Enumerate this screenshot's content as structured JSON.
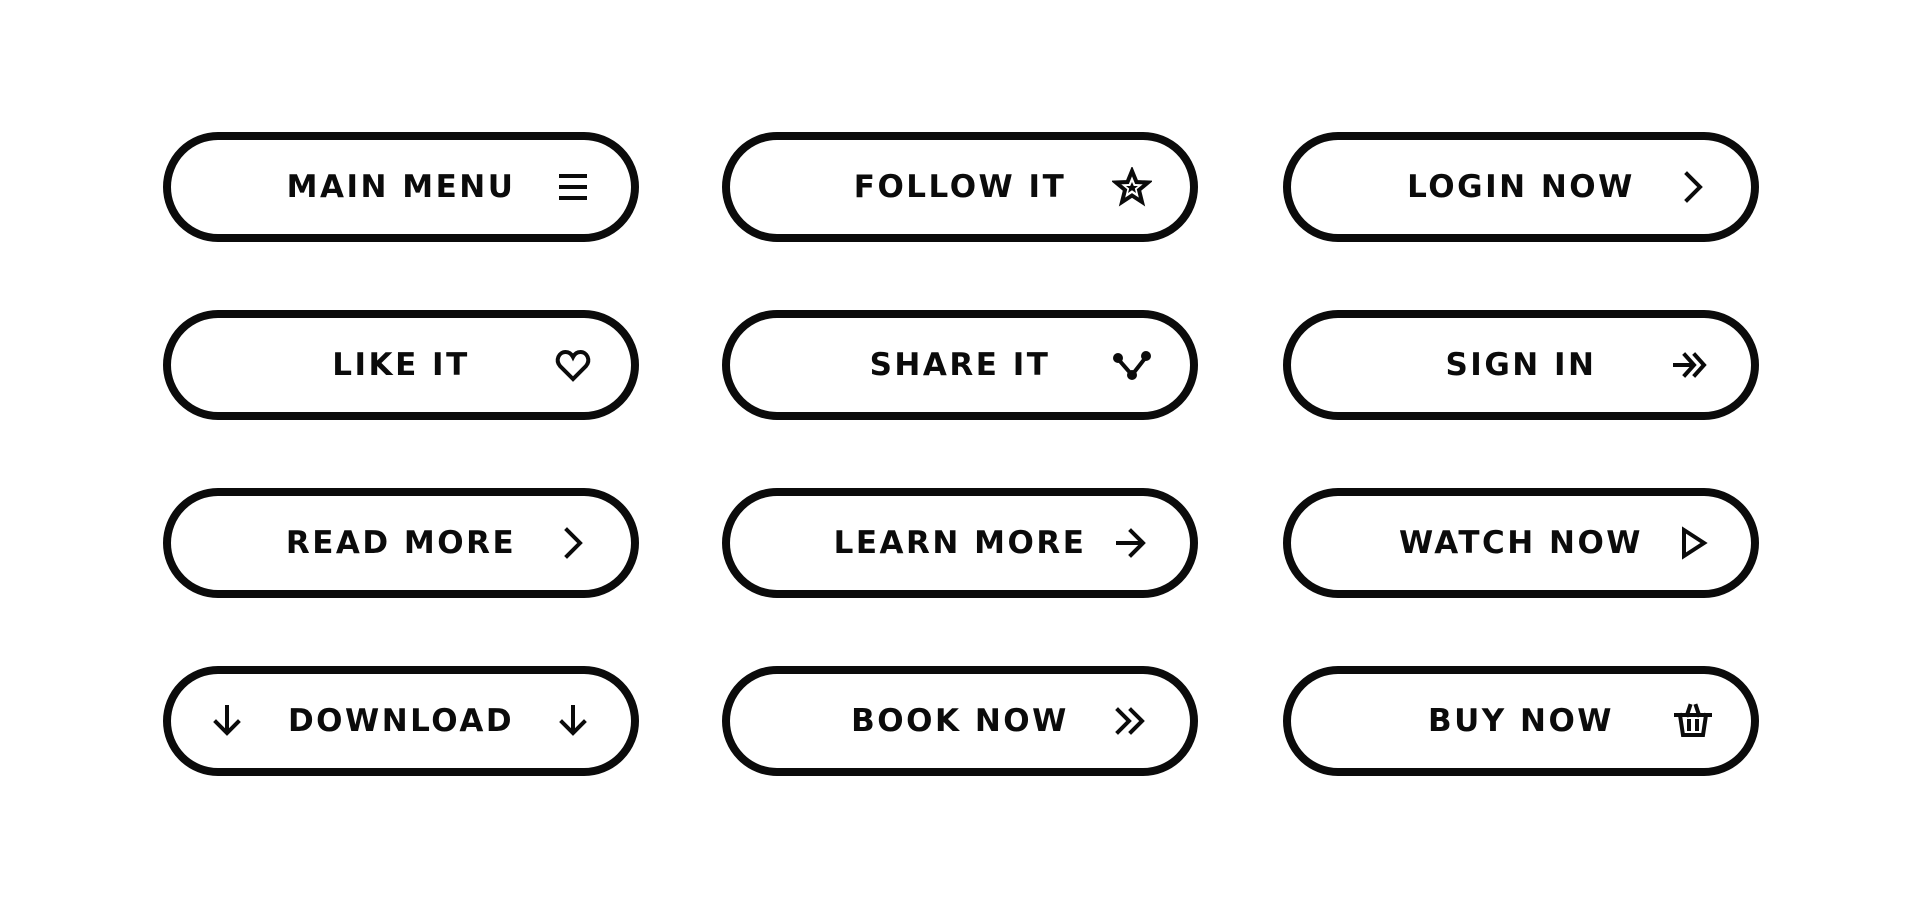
{
  "colors": {
    "stroke": "#0b0b0b",
    "background": "#ffffff"
  },
  "buttons": [
    {
      "label": "MAIN MENU",
      "icon": "menu-icon"
    },
    {
      "label": "FOLLOW IT",
      "icon": "star-icon"
    },
    {
      "label": "LOGIN NOW",
      "icon": "chevron-right-icon"
    },
    {
      "label": "LIKE IT",
      "icon": "heart-icon"
    },
    {
      "label": "SHARE IT",
      "icon": "share-icon"
    },
    {
      "label": "SIGN IN",
      "icon": "sign-in-arrow-icon"
    },
    {
      "label": "READ MORE",
      "icon": "chevron-right-icon"
    },
    {
      "label": "LEARN MORE",
      "icon": "arrow-right-icon"
    },
    {
      "label": "WATCH NOW",
      "icon": "play-icon"
    },
    {
      "label": "DOWNLOAD",
      "icon": "arrow-down-icon",
      "left_icon": "arrow-down-icon"
    },
    {
      "label": "BOOK NOW",
      "icon": "double-chevron-right-icon"
    },
    {
      "label": "BUY NOW",
      "icon": "basket-icon"
    }
  ]
}
